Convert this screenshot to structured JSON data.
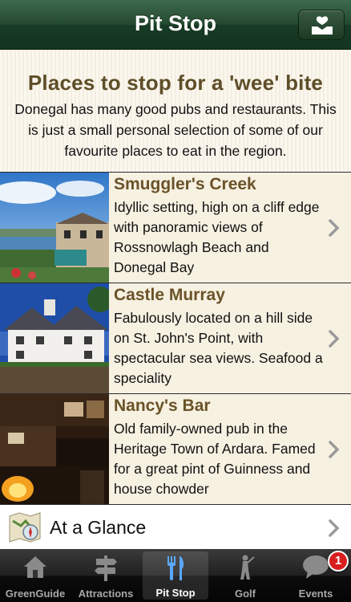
{
  "navbar": {
    "title": "Pit Stop",
    "right_icon": "hand-with-heart-icon"
  },
  "intro": {
    "title": "Places to stop for a 'wee' bite",
    "body": "Donegal has many good pubs and restaurants. This is just a small personal selection of some of our favourite places to eat in the region."
  },
  "places": [
    {
      "title": "Smuggler's Creek",
      "description": "Idyllic setting, high on a cliff edge with panoramic views of Rossnowlagh Beach and Donegal Bay"
    },
    {
      "title": "Castle Murray",
      "description": "Fabulously located on a hill side on St. John's Point, with spectacular sea views. Seafood a speciality"
    },
    {
      "title": "Nancy's Bar",
      "description": "Old family-owned pub in the Heritage Town of Ardara. Famed for a great pint of Guinness and house chowder"
    }
  ],
  "glance": {
    "label": "At a Glance",
    "icon": "map-compass-icon"
  },
  "tabs": [
    {
      "label": "GreenGuide",
      "icon": "house-icon"
    },
    {
      "label": "Attractions",
      "icon": "signpost-icon"
    },
    {
      "label": "Pit Stop",
      "icon": "fork-knife-icon",
      "active": true
    },
    {
      "label": "Golf",
      "icon": "golfer-icon"
    },
    {
      "label": "Events",
      "icon": "speech-bubble-icon",
      "badge": "1"
    }
  ],
  "colors": {
    "navbar": "#23492f",
    "title_brown": "#5e4e28",
    "row_background": "#f7f1e2",
    "badge_red": "#d81e1e"
  }
}
